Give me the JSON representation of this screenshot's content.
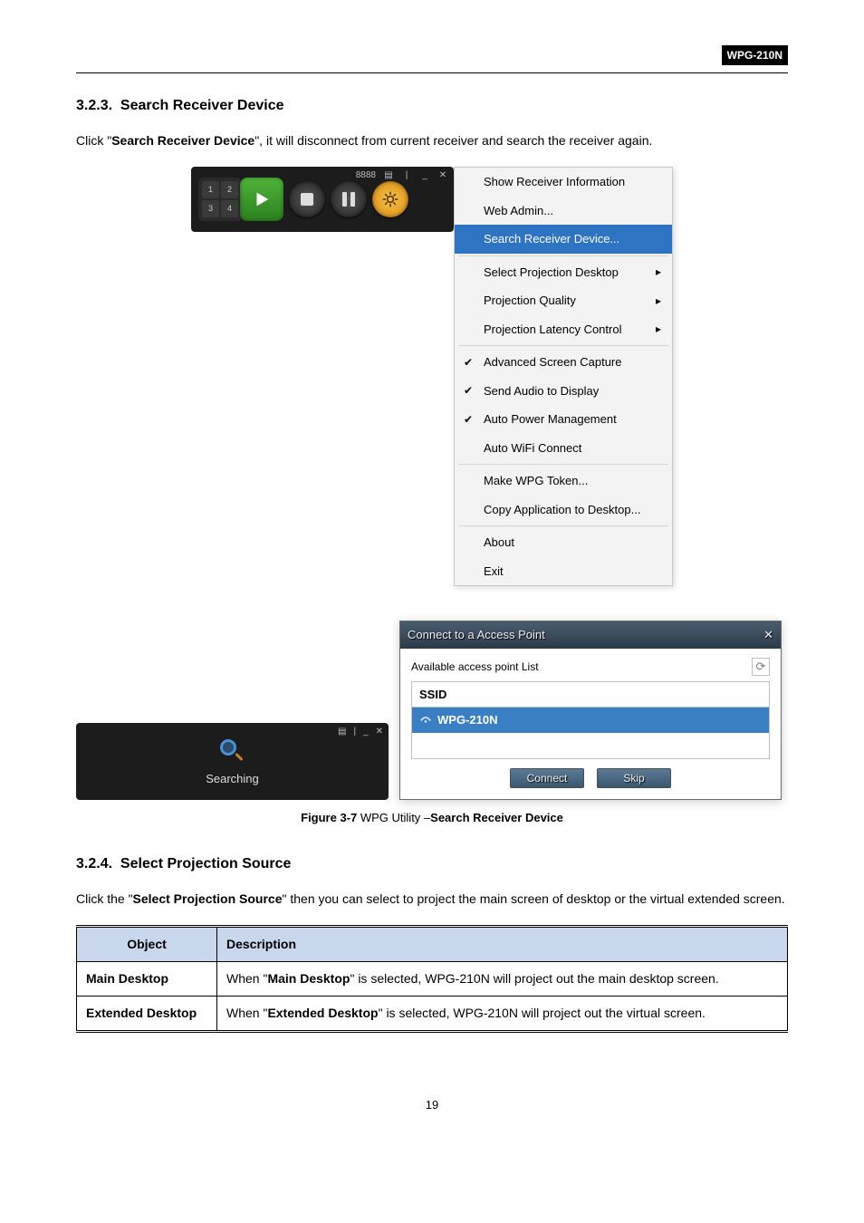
{
  "model_badge": "WPG-210N",
  "sections": {
    "s1": {
      "number": "3.2.3.",
      "title": "Search Receiver Device",
      "intro_a": "Click \"",
      "intro_b": "Search Receiver Device",
      "intro_c": "\", it will disconnect from current receiver and search the receiver again."
    },
    "s2": {
      "number": "3.2.4.",
      "title": "Select Projection Source",
      "intro_a": "Click the \"",
      "intro_b": "Select Projection Source",
      "intro_c": "\" then you can select to project the main screen of desktop or the virtual extended screen."
    }
  },
  "toolbar_code": "8888",
  "quad": {
    "q1": "1",
    "q2": "2",
    "q3": "3",
    "q4": "4"
  },
  "win_ctrls": {
    "menu": "▤",
    "sep": "|",
    "min": "_",
    "close": "✕"
  },
  "menu": {
    "show_info": "Show Receiver Information",
    "web_admin": "Web Admin...",
    "search_recv": "Search Receiver Device...",
    "sel_proj_desktop": "Select Projection Desktop",
    "proj_quality": "Projection Quality",
    "proj_latency": "Projection Latency Control",
    "adv_capture": "Advanced Screen Capture",
    "send_audio": "Send Audio to Display",
    "auto_pm": "Auto Power Management",
    "auto_wifi": "Auto WiFi Connect",
    "make_token": "Make WPG Token...",
    "copy_app": "Copy Application to Desktop...",
    "about": "About",
    "exit": "Exit",
    "arrow": "▸"
  },
  "searching_label": "Searching",
  "ap_dialog": {
    "title": "Connect to a Access Point",
    "close_glyph": "✕",
    "avail_label": "Available access point List",
    "refresh_glyph": "⟳",
    "col_ssid": "SSID",
    "row1": "WPG-210N",
    "connect": "Connect",
    "skip": "Skip"
  },
  "figure_caption_a": "Figure 3-7",
  "figure_caption_b": " WPG Utility –",
  "figure_caption_c": "Search Receiver Device",
  "table": {
    "hdr_object": "Object",
    "hdr_desc": "Description",
    "r1_obj": "Main Desktop",
    "r1_a": "When \"",
    "r1_b": "Main Desktop",
    "r1_c": "\" is selected, WPG-210N will project out the main desktop screen.",
    "r2_obj": "Extended Desktop",
    "r2_a": "When \"",
    "r2_b": "Extended Desktop",
    "r2_c": "\" is selected, WPG-210N will project out the virtual screen."
  },
  "page_number": "19"
}
